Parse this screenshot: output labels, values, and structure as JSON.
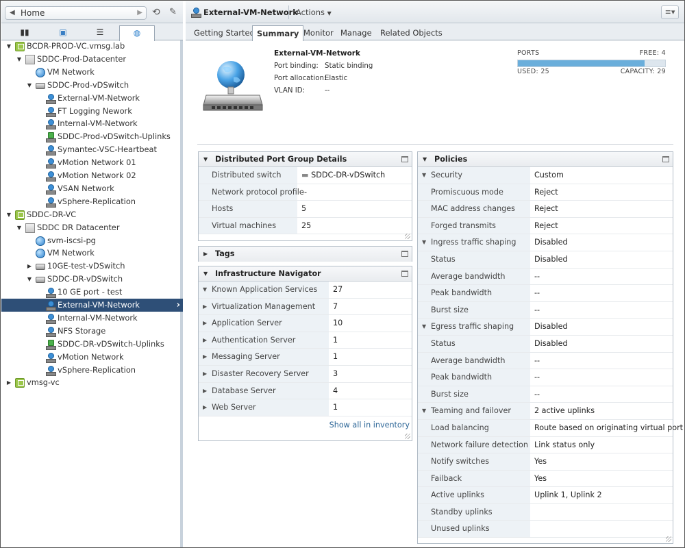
{
  "nav": {
    "home_label": "Home"
  },
  "panel_tabs": [
    "hosts-and-clusters",
    "vms-and-templates",
    "storage",
    "networking"
  ],
  "tree": [
    {
      "label": "BCDR-PROD-VC.vmsg.lab",
      "icon": "vcenter-icon",
      "level": 0,
      "exp": "open"
    },
    {
      "label": "SDDC-Prod-Datacenter",
      "icon": "datacenter-icon",
      "level": 1,
      "exp": "open"
    },
    {
      "label": "VM Network",
      "icon": "network-icon",
      "level": 2,
      "exp": ""
    },
    {
      "label": "SDDC-Prod-vDSwitch",
      "icon": "dvswitch-icon",
      "level": 2,
      "exp": "open"
    },
    {
      "label": "External-VM-Network",
      "icon": "portgroup-icon",
      "level": 3,
      "exp": ""
    },
    {
      "label": "FT Logging Nework",
      "icon": "portgroup-icon",
      "level": 3,
      "exp": ""
    },
    {
      "label": "Internal-VM-Network",
      "icon": "portgroup-icon",
      "level": 3,
      "exp": ""
    },
    {
      "label": "SDDC-Prod-vDSwitch-Uplinks",
      "icon": "uplink-portgroup-icon",
      "level": 3,
      "exp": ""
    },
    {
      "label": "Symantec-VSC-Heartbeat",
      "icon": "portgroup-icon",
      "level": 3,
      "exp": ""
    },
    {
      "label": "vMotion Network 01",
      "icon": "portgroup-icon",
      "level": 3,
      "exp": ""
    },
    {
      "label": "vMotion Network 02",
      "icon": "portgroup-icon",
      "level": 3,
      "exp": ""
    },
    {
      "label": "VSAN Network",
      "icon": "portgroup-icon",
      "level": 3,
      "exp": ""
    },
    {
      "label": "vSphere-Replication",
      "icon": "portgroup-icon",
      "level": 3,
      "exp": ""
    },
    {
      "label": "SDDC-DR-VC",
      "icon": "vcenter-icon",
      "level": 0,
      "exp": "open"
    },
    {
      "label": "SDDC DR Datacenter",
      "icon": "datacenter-icon",
      "level": 1,
      "exp": "open"
    },
    {
      "label": "svm-iscsi-pg",
      "icon": "network-icon",
      "level": 2,
      "exp": ""
    },
    {
      "label": "VM Network",
      "icon": "network-icon",
      "level": 2,
      "exp": ""
    },
    {
      "label": "10GE-test-vDSwitch",
      "icon": "dvswitch-icon",
      "level": 2,
      "exp": "closed"
    },
    {
      "label": "SDDC-DR-vDSwitch",
      "icon": "dvswitch-icon",
      "level": 2,
      "exp": "open"
    },
    {
      "label": "10 GE port - test",
      "icon": "portgroup-icon",
      "level": 3,
      "exp": ""
    },
    {
      "label": "External-VM-Network",
      "icon": "portgroup-icon",
      "level": 3,
      "exp": "",
      "selected": true
    },
    {
      "label": "Internal-VM-Network",
      "icon": "portgroup-icon",
      "level": 3,
      "exp": ""
    },
    {
      "label": "NFS Storage",
      "icon": "portgroup-icon",
      "level": 3,
      "exp": ""
    },
    {
      "label": "SDDC-DR-vDSwitch-Uplinks",
      "icon": "uplink-portgroup-icon",
      "level": 3,
      "exp": ""
    },
    {
      "label": "vMotion Network",
      "icon": "portgroup-icon",
      "level": 3,
      "exp": ""
    },
    {
      "label": "vSphere-Replication",
      "icon": "portgroup-icon",
      "level": 3,
      "exp": ""
    },
    {
      "label": "vmsg-vc",
      "icon": "vcenter-icon",
      "level": 0,
      "exp": "closed"
    }
  ],
  "header": {
    "title": "External-VM-Network",
    "actions_label": "Actions"
  },
  "tabs": [
    "Getting Started",
    "Summary",
    "Monitor",
    "Manage",
    "Related Objects"
  ],
  "summary": {
    "name": "External-VM-Network",
    "rows": [
      {
        "label": "Port binding:",
        "value": "Static binding"
      },
      {
        "label": "Port allocation:",
        "value": "Elastic"
      },
      {
        "label": "VLAN ID:",
        "value": "--"
      }
    ],
    "ports": {
      "title": "PORTS",
      "free": "FREE: 4",
      "used": "USED: 25",
      "capacity": "CAPACITY: 29",
      "used_fraction": 0.862
    }
  },
  "dpg_details": {
    "title": "Distributed Port Group Details",
    "rows": [
      {
        "label": "Distributed switch",
        "value": "SDDC-DR-vDSwitch",
        "link": true
      },
      {
        "label": "Network protocol profile",
        "value": "--"
      },
      {
        "label": "Hosts",
        "value": "5"
      },
      {
        "label": "Virtual machines",
        "value": "25"
      }
    ]
  },
  "tags": {
    "title": "Tags"
  },
  "infra_nav": {
    "title": "Infrastructure Navigator",
    "rows": [
      {
        "label": "Known Application Services",
        "value": "27",
        "exp": "open"
      },
      {
        "label": "Virtualization Management",
        "value": "7",
        "exp": "closed"
      },
      {
        "label": "Application Server",
        "value": "10",
        "exp": "closed"
      },
      {
        "label": "Authentication Server",
        "value": "1",
        "exp": "closed"
      },
      {
        "label": "Messaging Server",
        "value": "1",
        "exp": "closed"
      },
      {
        "label": "Disaster Recovery Server",
        "value": "3",
        "exp": "closed"
      },
      {
        "label": "Database Server",
        "value": "4",
        "exp": "closed"
      },
      {
        "label": "Web Server",
        "value": "1",
        "exp": "closed"
      }
    ],
    "show_all": "Show all in inventory"
  },
  "policies": {
    "title": "Policies",
    "rows": [
      {
        "label": "Security",
        "value": "Custom",
        "group": true
      },
      {
        "label": "Promiscuous mode",
        "value": "Reject"
      },
      {
        "label": "MAC address changes",
        "value": "Reject"
      },
      {
        "label": "Forged transmits",
        "value": "Reject"
      },
      {
        "label": "Ingress traffic shaping",
        "value": "Disabled",
        "group": true
      },
      {
        "label": "Status",
        "value": "Disabled"
      },
      {
        "label": "Average bandwidth",
        "value": "--"
      },
      {
        "label": "Peak bandwidth",
        "value": "--"
      },
      {
        "label": "Burst size",
        "value": "--"
      },
      {
        "label": "Egress traffic shaping",
        "value": "Disabled",
        "group": true
      },
      {
        "label": "Status",
        "value": "Disabled"
      },
      {
        "label": "Average bandwidth",
        "value": "--"
      },
      {
        "label": "Peak bandwidth",
        "value": "--"
      },
      {
        "label": "Burst size",
        "value": "--"
      },
      {
        "label": "Teaming and failover",
        "value": "2 active uplinks",
        "group": true
      },
      {
        "label": "Load balancing",
        "value": "Route based on originating virtual port"
      },
      {
        "label": "Network failure detection",
        "value": "Link status only"
      },
      {
        "label": "Notify switches",
        "value": "Yes"
      },
      {
        "label": "Failback",
        "value": "Yes"
      },
      {
        "label": "Active uplinks",
        "value": "Uplink 1, Uplink 2"
      },
      {
        "label": "Standby uplinks",
        "value": ""
      },
      {
        "label": "Unused uplinks",
        "value": ""
      }
    ]
  }
}
